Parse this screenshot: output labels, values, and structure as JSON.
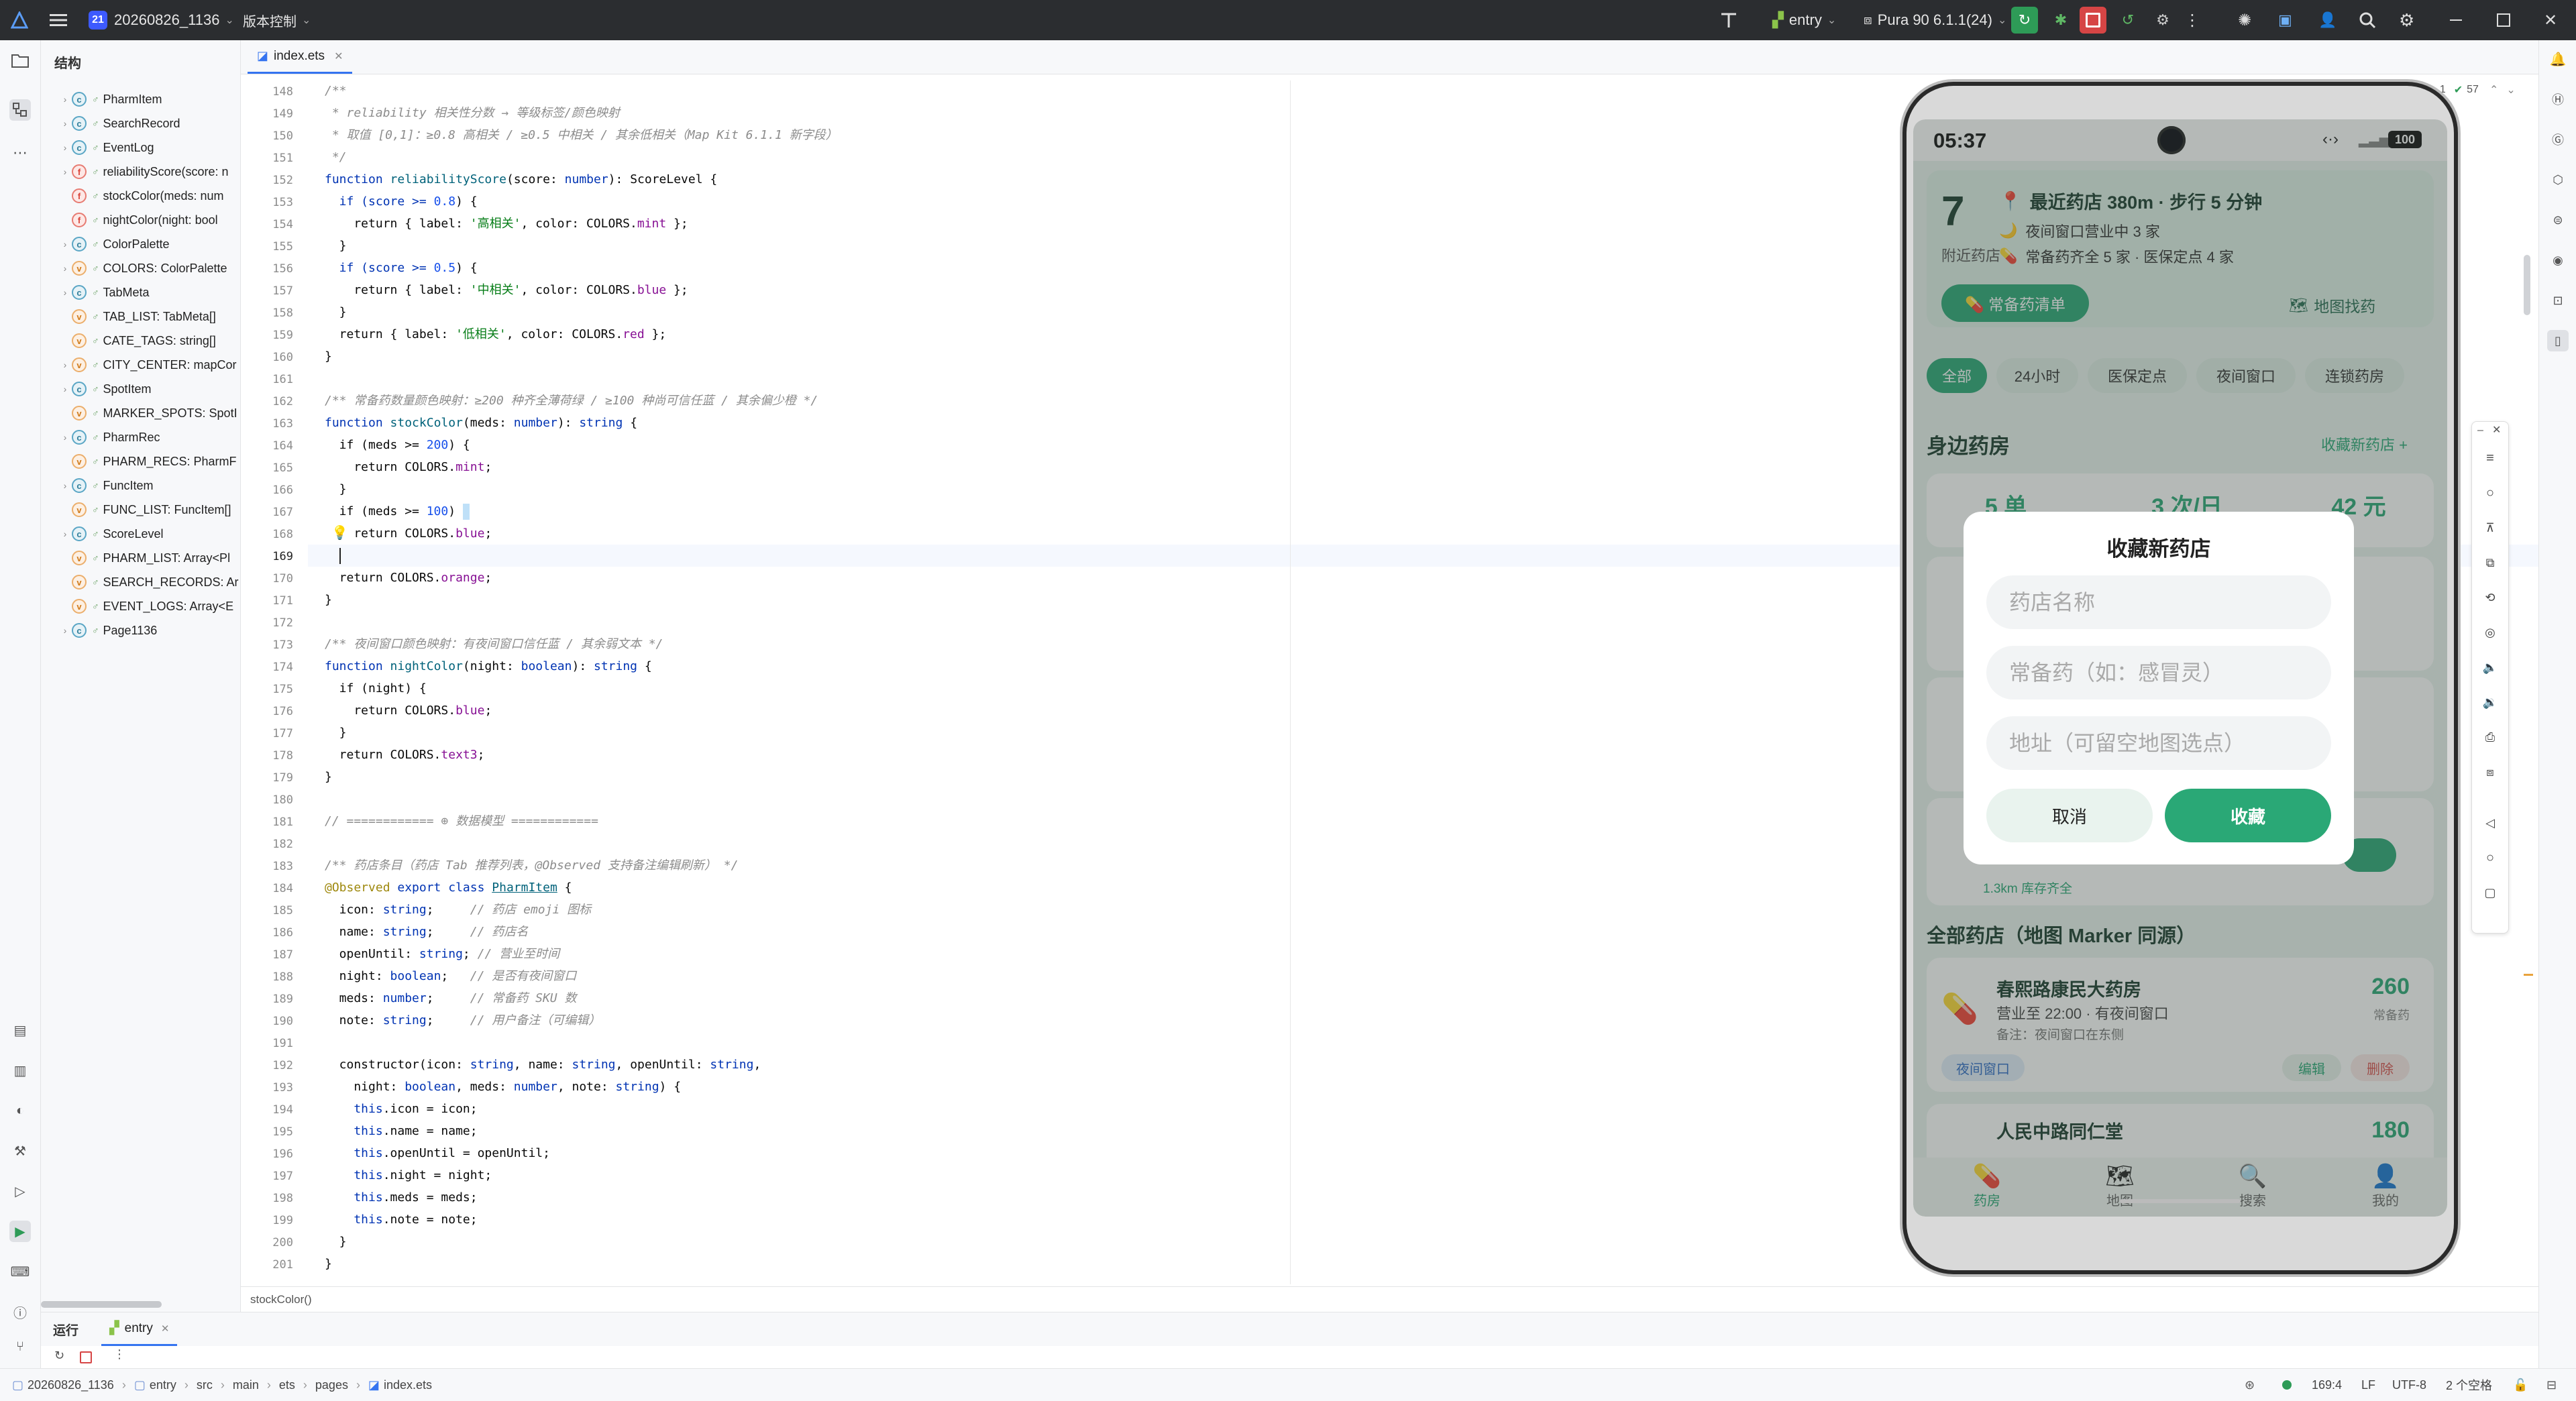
{
  "titlebar": {
    "project_badge": "21",
    "project_name": "20260826_1136",
    "vcs_label": "版本控制",
    "run_config": "entry",
    "device": "Pura 90 6.1.1(24)"
  },
  "structure": {
    "header": "结构",
    "items": [
      {
        "badge": "c",
        "name": "PharmItem",
        "expand": true
      },
      {
        "badge": "c",
        "name": "SearchRecord",
        "expand": true
      },
      {
        "badge": "c",
        "name": "EventLog",
        "expand": true
      },
      {
        "badge": "f",
        "name": "reliabilityScore(score: n",
        "expand": true
      },
      {
        "badge": "f",
        "name": "stockColor(meds: num",
        "expand": false
      },
      {
        "badge": "f",
        "name": "nightColor(night: bool",
        "expand": false
      },
      {
        "badge": "c",
        "name": "ColorPalette",
        "expand": true
      },
      {
        "badge": "v",
        "name": "COLORS: ColorPalette",
        "expand": true
      },
      {
        "badge": "c",
        "name": "TabMeta",
        "expand": true
      },
      {
        "badge": "v",
        "name": "TAB_LIST: TabMeta[]",
        "expand": false
      },
      {
        "badge": "v",
        "name": "CATE_TAGS: string[]",
        "expand": false
      },
      {
        "badge": "v",
        "name": "CITY_CENTER: mapCor",
        "expand": true
      },
      {
        "badge": "c",
        "name": "SpotItem",
        "expand": true
      },
      {
        "badge": "v",
        "name": "MARKER_SPOTS: SpotI",
        "expand": false
      },
      {
        "badge": "c",
        "name": "PharmRec",
        "expand": true
      },
      {
        "badge": "v",
        "name": "PHARM_RECS: PharmF",
        "expand": false
      },
      {
        "badge": "c",
        "name": "FuncItem",
        "expand": true
      },
      {
        "badge": "v",
        "name": "FUNC_LIST: FuncItem[]",
        "expand": false
      },
      {
        "badge": "c",
        "name": "ScoreLevel",
        "expand": true
      },
      {
        "badge": "v",
        "name": "PHARM_LIST: Array<Pl",
        "expand": false
      },
      {
        "badge": "v",
        "name": "SEARCH_RECORDS: Ar",
        "expand": false
      },
      {
        "badge": "v",
        "name": "EVENT_LOGS: Array<E",
        "expand": false
      },
      {
        "badge": "c",
        "name": "Page1136",
        "expand": true
      }
    ]
  },
  "editor": {
    "tab_name": "index.ets",
    "line_numbers": [
      "148",
      "149",
      "150",
      "151",
      "152",
      "153",
      "154",
      "155",
      "156",
      "157",
      "158",
      "159",
      "160",
      "161",
      "162",
      "163",
      "164",
      "165",
      "166",
      "167",
      "168",
      "169",
      "170",
      "171",
      "172",
      "173",
      "174",
      "175",
      "176",
      "177",
      "178",
      "179",
      "180",
      "181",
      "182",
      "183",
      "184",
      "185",
      "186",
      "187",
      "188",
      "189",
      "190",
      "191",
      "192",
      "193",
      "194",
      "195",
      "196",
      "197",
      "198",
      "199",
      "200",
      "201"
    ],
    "inspection_warnings": "1",
    "inspection_ok": "57",
    "bottom_breadcrumb": "stockColor()"
  },
  "code": {
    "l148": "/**",
    "l149": " * reliability 相关性分数 → 等级标签/颜色映射",
    "l150": " * 取值 [0,1]：≥0.8 高相关 / ≥0.5 中相关 / 其余低相关（Map Kit 6.1.1 新字段）",
    "l151": " */",
    "l152a": "function ",
    "l152b": "reliabilityScore",
    "l152c": "(score: ",
    "l152d": "number",
    "l152e": "): ",
    "l152f": "ScoreLevel",
    "l152g": " {",
    "l153a": "  if (score >= ",
    "l153b": "0.8",
    "l153c": ") {",
    "l154a": "    return { label: ",
    "l154b": "'高相关'",
    "l154c": ", color: COLORS.",
    "l154d": "mint",
    "l154e": " };",
    "l155": "  }",
    "l156a": "  if (score >= ",
    "l156b": "0.5",
    "l156c": ") {",
    "l157a": "    return { label: ",
    "l157b": "'中相关'",
    "l157c": ", color: COLORS.",
    "l157d": "blue",
    "l157e": " };",
    "l158": "  }",
    "l159a": "  return { label: ",
    "l159b": "'低相关'",
    "l159c": ", color: COLORS.",
    "l159d": "red",
    "l159e": " };",
    "l160": "}",
    "l162": "/** 常备药数量颜色映射：≥200 种齐全薄荷绿 / ≥100 种尚可信任蓝 / 其余偏少橙 */",
    "l163a": "function ",
    "l163b": "stockColor",
    "l163c": "(meds: ",
    "l163d": "number",
    "l163e": "): ",
    "l163f": "string",
    "l163g": " {",
    "l164a": "  if (meds >= ",
    "l164b": "200",
    "l164c": ") {",
    "l165a": "    return COLORS.",
    "l165b": "mint",
    "l165c": ";",
    "l166": "  }",
    "l167a": "  if (meds >= ",
    "l167b": "100",
    "l167c": ") ",
    "l168a": "    return COLORS.",
    "l168b": "blue",
    "l168c": ";",
    "l170a": "  return COLORS.",
    "l170b": "orange",
    "l170c": ";",
    "l171": "}",
    "l173": "/** 夜间窗口颜色映射：有夜间窗口信任蓝 / 其余弱文本 */",
    "l174a": "function ",
    "l174b": "nightColor",
    "l174c": "(night: ",
    "l174d": "boolean",
    "l174e": "): ",
    "l174f": "string",
    "l174g": " {",
    "l175": "  if (night) {",
    "l176a": "    return COLORS.",
    "l176b": "blue",
    "l176c": ";",
    "l177": "  }",
    "l178a": "  return COLORS.",
    "l178b": "text3",
    "l178c": ";",
    "l179": "}",
    "l181": "// ============ ⊕ 数据模型 ============",
    "l183": "/** 药店条目（药店 Tab 推荐列表，@Observed 支持备注编辑刷新） */",
    "l184a": "@Observed ",
    "l184b": "export class ",
    "l184c": "PharmItem",
    "l184d": " {",
    "l185a": "  icon: ",
    "l185b": "string",
    "l185c": ";     ",
    "l185d": "// 药店 emoji 图标",
    "l186a": "  name: ",
    "l186b": "string",
    "l186c": ";     ",
    "l186d": "// 药店名",
    "l187a": "  openUntil: ",
    "l187b": "string",
    "l187c": "; ",
    "l187d": "// 营业至时间",
    "l188a": "  night: ",
    "l188b": "boolean",
    "l188c": ";   ",
    "l188d": "// 是否有夜间窗口",
    "l189a": "  meds: ",
    "l189b": "number",
    "l189c": ";     ",
    "l189d": "// 常备药 SKU 数",
    "l190a": "  note: ",
    "l190b": "string",
    "l190c": ";     ",
    "l190d": "// 用户备注（可编辑）",
    "l192a": "  constructor(icon: ",
    "l192b": "string",
    "l192c": ", name: ",
    "l192d": "string",
    "l192e": ", openUntil: ",
    "l192f": "string",
    "l192g": ",",
    "l193a": "    night: ",
    "l193b": "boolean",
    "l193c": ", meds: ",
    "l193d": "number",
    "l193e": ", note: ",
    "l193f": "string",
    "l193g": ") {",
    "l194a": "    this",
    "l194b": ".icon = icon;",
    "l195a": "    this",
    "l195b": ".name = name;",
    "l196a": "    this",
    "l196b": ".openUntil = openUntil;",
    "l197a": "    this",
    "l197b": ".night = night;",
    "l198a": "    this",
    "l198b": ".meds = meds;",
    "l199a": "    this",
    "l199b": ".note = note;",
    "l200": "  }",
    "l201": "}"
  },
  "run": {
    "label": "运行",
    "tab": "entry"
  },
  "statusbar": {
    "path": [
      "20260826_1136",
      "entry",
      "src",
      "main",
      "ets",
      "pages",
      "index.ets"
    ],
    "position": "169:4",
    "line_sep": "LF",
    "encoding": "UTF-8",
    "indent": "2 个空格"
  },
  "phone": {
    "time": "05:37",
    "battery": "100",
    "summary": {
      "count": "7",
      "count_label": "附近药店",
      "nearest": "最近药店 380m · 步行 5 分钟",
      "night_open": "夜间窗口营业中 3 家",
      "stock_info": "常备药齐全 5 家 · 医保定点 4 家",
      "stock_list_button": "💊 常备药清单",
      "map_find": "地图找药"
    },
    "chips": [
      "全部",
      "24小时",
      "医保定点",
      "夜间窗口",
      "连锁药房"
    ],
    "nearby_title": "身边药房",
    "fav_link": "收藏新药店 +",
    "stats": [
      "5 单",
      "3 次/日",
      "42 元"
    ],
    "partial_row_text": "1.3km   库存齐全",
    "all_title": "全部药店（地图 Marker 同源）",
    "pharm1": {
      "name": "春熙路康民大药房",
      "hours": "营业至 22:00 · 有夜间窗口",
      "note": "备注：夜间窗口在东侧",
      "count": "260",
      "count_label": "常备药",
      "tag": "夜间窗口",
      "edit": "编辑",
      "delete": "删除"
    },
    "pharm2": {
      "name": "人民中路同仁堂",
      "count": "180"
    },
    "nav": [
      "药房",
      "地图",
      "搜索",
      "我的"
    ],
    "dialog": {
      "title": "收藏新药店",
      "name_placeholder": "药店名称",
      "med_placeholder": "常备药（如：感冒灵）",
      "addr_placeholder": "地址（可留空地图选点）",
      "cancel": "取消",
      "confirm": "收藏"
    }
  },
  "colors": {
    "accent_green": "#2aa876",
    "ide_blue": "#3574f0",
    "titlebar_bg": "#2b2d30"
  }
}
